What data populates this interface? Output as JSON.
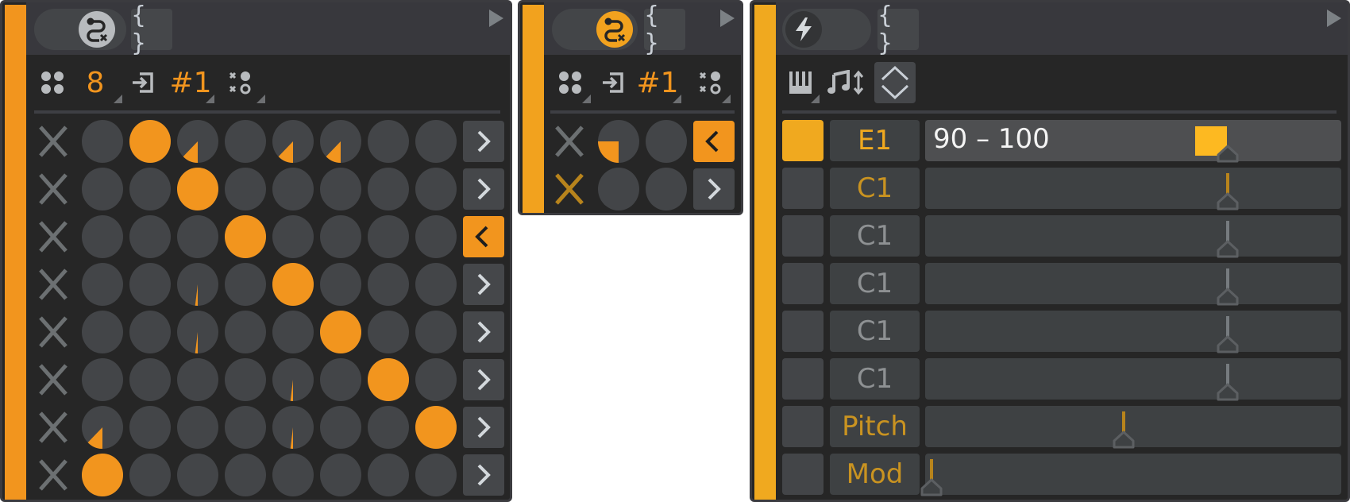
{
  "colors": {
    "accent": "#f2951e",
    "accent_yellow": "#f0a91f",
    "dim_accent": "#b8841c",
    "cell_off": "#434548",
    "panel_bg": "#262626",
    "header_bg": "#38383d"
  },
  "panel_left": {
    "header": {
      "toggle_icon": "connection-x-icon",
      "toggle_active": false,
      "braces_label": "{ }"
    },
    "toolbar": {
      "steps_value": "8",
      "channel_value": "#1"
    },
    "grid": {
      "rows": [
        {
          "enabled": false,
          "cells": [
            0,
            1,
            0.375,
            0,
            0.375,
            0.375,
            0,
            0
          ],
          "direction": "right"
        },
        {
          "enabled": false,
          "cells": [
            0,
            0,
            1,
            0,
            0,
            0,
            0,
            0
          ],
          "direction": "right"
        },
        {
          "enabled": false,
          "cells": [
            0,
            0,
            0,
            1,
            0,
            0,
            0,
            0
          ],
          "direction": "left"
        },
        {
          "enabled": false,
          "cells": [
            0,
            0,
            0.48,
            0,
            1,
            0,
            0,
            0
          ],
          "direction": "right"
        },
        {
          "enabled": false,
          "cells": [
            0,
            0,
            0.48,
            0,
            0,
            1,
            0,
            0
          ],
          "direction": "right"
        },
        {
          "enabled": false,
          "cells": [
            0,
            0,
            0,
            0,
            0.48,
            0,
            1,
            0
          ],
          "direction": "right"
        },
        {
          "enabled": false,
          "cells": [
            0.375,
            0,
            0,
            0,
            0.48,
            0,
            0,
            1
          ],
          "direction": "right"
        },
        {
          "enabled": false,
          "cells": [
            1,
            0,
            0,
            0,
            0,
            0,
            0,
            0
          ],
          "direction": "right"
        }
      ]
    }
  },
  "panel_middle": {
    "header": {
      "toggle_icon": "connection-x-icon",
      "toggle_active": true,
      "braces_label": "{ }"
    },
    "toolbar": {
      "channel_value": "#1"
    },
    "grid": {
      "rows": [
        {
          "enabled": false,
          "cells": [
            0.25,
            0.5
          ],
          "direction": "left"
        },
        {
          "enabled": true,
          "cells": [
            0,
            0
          ],
          "direction": "right"
        }
      ]
    }
  },
  "panel_right": {
    "header": {
      "toggle_icon": "lightning-icon",
      "toggle_active": false,
      "braces_label": "{ }"
    },
    "rows": [
      {
        "selected": true,
        "label": "E1",
        "label_state": "active",
        "range_text": "90 – 100",
        "value": 0.77,
        "marker": "block"
      },
      {
        "selected": false,
        "label": "C1",
        "label_state": "dim-active",
        "value": 0.77,
        "marker": "line-accent"
      },
      {
        "selected": false,
        "label": "C1",
        "label_state": "inactive",
        "value": 0.77,
        "marker": "line-gray"
      },
      {
        "selected": false,
        "label": "C1",
        "label_state": "inactive",
        "value": 0.77,
        "marker": "line-gray"
      },
      {
        "selected": false,
        "label": "C1",
        "label_state": "inactive",
        "value": 0.77,
        "marker": "line-gray"
      },
      {
        "selected": false,
        "label": "C1",
        "label_state": "inactive",
        "value": 0.77,
        "marker": "line-gray"
      },
      {
        "selected": false,
        "label": "Pitch",
        "label_state": "dim-active",
        "value": 0.5,
        "marker": "line-accent"
      },
      {
        "selected": false,
        "label": "Mod",
        "label_state": "dim-active",
        "value": 0.0,
        "marker": "line-accent"
      }
    ]
  }
}
